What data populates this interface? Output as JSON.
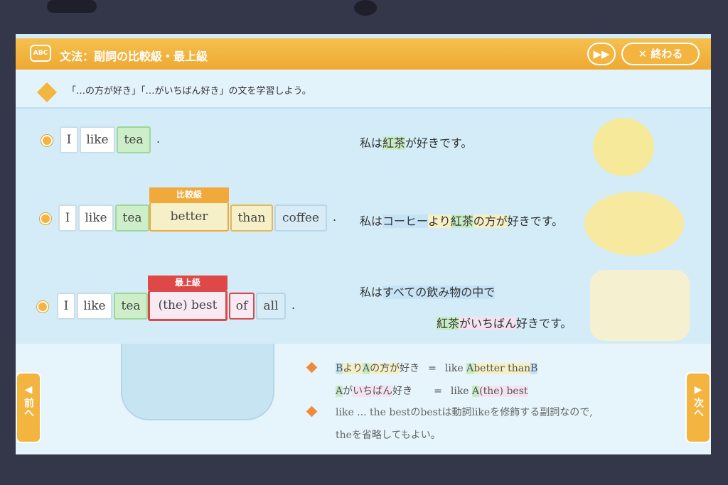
{
  "header": {
    "icon": "abc-speech-icon",
    "icon_text": "ABC",
    "title": "文法：副詞の比較級・最上級",
    "skip_icon": "fast-forward-icon",
    "close_icon": "x-icon",
    "end_label": "終わる"
  },
  "subtitle": "「…の方が好き」「…がいちばん好き」の文を学習しよう。",
  "rows": [
    {
      "tiles": [
        "I",
        "like",
        "tea"
      ],
      "period": ".",
      "japanese": {
        "parts": [
          "私は",
          "紅茶",
          "が好きです。"
        ]
      }
    },
    {
      "tiles": [
        "I",
        "like",
        "tea",
        "better",
        "than",
        "coffee"
      ],
      "label": "比較級",
      "period": ".",
      "japanese": {
        "parts": [
          "私は",
          "コーヒー",
          "より",
          "紅茶",
          "の方が",
          "好きです。"
        ]
      }
    },
    {
      "tiles": [
        "I",
        "like",
        "tea",
        "(the) best",
        "of",
        "all"
      ],
      "label": "最上級",
      "period": ".",
      "japanese": {
        "line1": [
          "私は",
          "すべての飲み物の中で"
        ],
        "line2": [
          "紅茶",
          "がいちばん",
          "好きです。"
        ]
      }
    }
  ],
  "rules": {
    "r1_left": [
      "B",
      "より",
      "A",
      "の方が",
      "好き"
    ],
    "eq": "=",
    "r1_right": [
      "like",
      "A",
      "better than",
      "B"
    ],
    "r2_left": [
      "A",
      "が",
      "いちばん",
      "好き"
    ],
    "r2_right": [
      "like",
      "A",
      "(the) best"
    ],
    "note1": "like ... the bestのbestは動詞likeを修飾する副詞なので,",
    "note2": "theを省略してもよい。"
  },
  "nav": {
    "prev_icon": "triangle-left-icon",
    "prev": "前へ",
    "next_icon": "triangle-right-icon",
    "next": "次へ"
  },
  "colors": {
    "header": "#eea932",
    "green": "#c7ecc4",
    "yellow": "#f5efc6",
    "blue": "#c6e3f5",
    "pink": "#f4e2f1",
    "comparative": "#f0a93a",
    "superlative": "#e04848"
  }
}
